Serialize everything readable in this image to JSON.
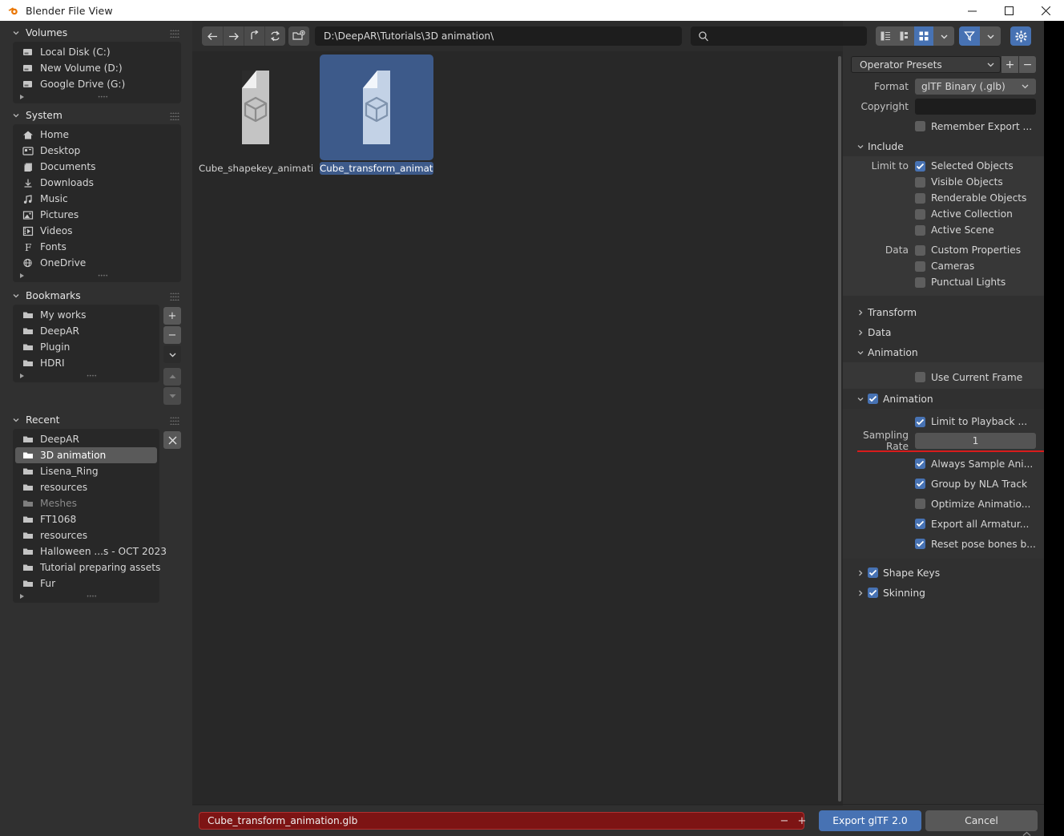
{
  "window": {
    "title": "Blender File View",
    "app_icon": "blender-logo-icon",
    "minimize": "minimize-icon",
    "maximize": "maximize-icon",
    "close": "close-icon"
  },
  "sidebar": {
    "panels": [
      {
        "title": "Volumes",
        "items": [
          {
            "label": "Local Disk (C:)",
            "icon": "disk-icon"
          },
          {
            "label": "New Volume (D:)",
            "icon": "disk-icon"
          },
          {
            "label": "Google Drive (G:)",
            "icon": "disk-icon"
          }
        ]
      },
      {
        "title": "System",
        "items": [
          {
            "label": "Home",
            "icon": "home-icon"
          },
          {
            "label": "Desktop",
            "icon": "desktop-icon"
          },
          {
            "label": "Documents",
            "icon": "documents-icon"
          },
          {
            "label": "Downloads",
            "icon": "download-icon"
          },
          {
            "label": "Music",
            "icon": "music-note-icon"
          },
          {
            "label": "Pictures",
            "icon": "picture-icon"
          },
          {
            "label": "Videos",
            "icon": "film-icon"
          },
          {
            "label": "Fonts",
            "icon": "font-f-icon"
          },
          {
            "label": "OneDrive",
            "icon": "globe-icon"
          }
        ]
      },
      {
        "title": "Bookmarks",
        "items": [
          {
            "label": "My works",
            "icon": "folder-icon"
          },
          {
            "label": "DeepAR",
            "icon": "folder-icon"
          },
          {
            "label": "Plugin",
            "icon": "folder-icon"
          },
          {
            "label": "HDRI",
            "icon": "folder-icon"
          }
        ],
        "buttons": [
          {
            "name": "add-bookmark-button",
            "glyph": "+"
          },
          {
            "name": "remove-bookmark-button",
            "glyph": "−"
          },
          {
            "name": "bookmark-menu-button",
            "glyph": "chevron-down-icon"
          },
          {
            "name": "move-bookmark-up-button",
            "glyph": "triangle-up-icon"
          },
          {
            "name": "move-bookmark-down-button",
            "glyph": "triangle-down-icon"
          }
        ]
      },
      {
        "title": "Recent",
        "items": [
          {
            "label": "DeepAR",
            "icon": "folder-icon",
            "state": "normal"
          },
          {
            "label": "3D animation",
            "icon": "folder-icon",
            "state": "selected"
          },
          {
            "label": "Lisena_Ring",
            "icon": "folder-icon",
            "state": "normal"
          },
          {
            "label": "resources",
            "icon": "folder-icon",
            "state": "normal"
          },
          {
            "label": "Meshes",
            "icon": "folder-icon",
            "state": "disabled"
          },
          {
            "label": "FT1068",
            "icon": "folder-icon",
            "state": "normal"
          },
          {
            "label": "resources",
            "icon": "folder-icon",
            "state": "normal"
          },
          {
            "label": "Halloween ...s - OCT 2023",
            "icon": "folder-icon",
            "state": "normal"
          },
          {
            "label": "Tutorial preparing assets",
            "icon": "folder-icon",
            "state": "normal"
          },
          {
            "label": "Fur",
            "icon": "folder-icon",
            "state": "normal"
          }
        ],
        "clear_button": "clear-recent-button"
      }
    ]
  },
  "toolbar": {
    "back": "arrow-left-icon",
    "forward": "arrow-right-icon",
    "parent": "arrow-up-icon",
    "refresh": "refresh-icon",
    "new_folder": "new-folder-icon",
    "path_value": "D:\\DeepAR\\Tutorials\\3D animation\\",
    "search_placeholder": "",
    "search_value": "",
    "search_icon": "search-icon",
    "view_modes": [
      {
        "name": "view-vertical-list",
        "active": false
      },
      {
        "name": "view-horizontal-list",
        "active": false
      },
      {
        "name": "view-thumbnails",
        "active": true
      }
    ],
    "display_dropdown": "chevron-down-icon",
    "filter_icon": "filter-funnel-icon",
    "filter_dropdown": "chevron-down-icon",
    "settings_icon": "gear-icon"
  },
  "files": [
    {
      "label": "Cube_shapekey_animatio...",
      "icon": "gltf-file-icon",
      "selected": false
    },
    {
      "label": "Cube_transform_animatio...",
      "icon": "gltf-file-icon",
      "selected": true
    }
  ],
  "properties": {
    "presets": {
      "label": "Operator Presets",
      "add_button": "+",
      "remove_button": "−",
      "dropdown_icon": "chevron-down-icon"
    },
    "format": {
      "label": "Format",
      "value": "glTF Binary (.glb)"
    },
    "copyright": {
      "label": "Copyright",
      "value": ""
    },
    "remember_export": {
      "label": "Remember Export ...",
      "checked": false
    },
    "include": {
      "title": "Include",
      "limit_to_label": "Limit to",
      "limit_to": [
        {
          "label": "Selected Objects",
          "checked": true
        },
        {
          "label": "Visible Objects",
          "checked": false
        },
        {
          "label": "Renderable Objects",
          "checked": false
        },
        {
          "label": "Active Collection",
          "checked": false
        },
        {
          "label": "Active Scene",
          "checked": false
        }
      ],
      "data_label": "Data",
      "data": [
        {
          "label": "Custom Properties",
          "checked": false
        },
        {
          "label": "Cameras",
          "checked": false
        },
        {
          "label": "Punctual Lights",
          "checked": false
        }
      ]
    },
    "transform": {
      "title": "Transform",
      "expanded": false
    },
    "data_section": {
      "title": "Data",
      "expanded": false
    },
    "animation": {
      "title": "Animation",
      "expanded": true,
      "use_current_frame": {
        "label": "Use Current Frame",
        "checked": false
      },
      "sub_animation": {
        "label": "Animation",
        "checked": true
      },
      "limit_to_playback": {
        "label": "Limit to Playback ...",
        "checked": true
      },
      "sampling_rate": {
        "label": "Sampling Rate",
        "value": "1"
      },
      "options": [
        {
          "label": "Always Sample Ani...",
          "checked": true
        },
        {
          "label": "Group by NLA Track",
          "checked": true
        },
        {
          "label": "Optimize Animatio...",
          "checked": false
        },
        {
          "label": "Export all Armatur...",
          "checked": true
        },
        {
          "label": "Reset pose bones b...",
          "checked": true
        }
      ]
    },
    "shape_keys": {
      "title": "Shape Keys",
      "checked": true,
      "expanded": false
    },
    "skinning": {
      "title": "Skinning",
      "checked": true,
      "expanded": false
    }
  },
  "footer": {
    "filename": "Cube_transform_animation.glb",
    "decrement": "−",
    "increment": "+",
    "export_button": "Export glTF 2.0",
    "cancel_button": "Cancel"
  },
  "colors": {
    "accent_blue": "#4772b3",
    "highlight_red": "#d91b1b",
    "field_dark": "#1d1d1d",
    "panel_bg": "#303030"
  }
}
